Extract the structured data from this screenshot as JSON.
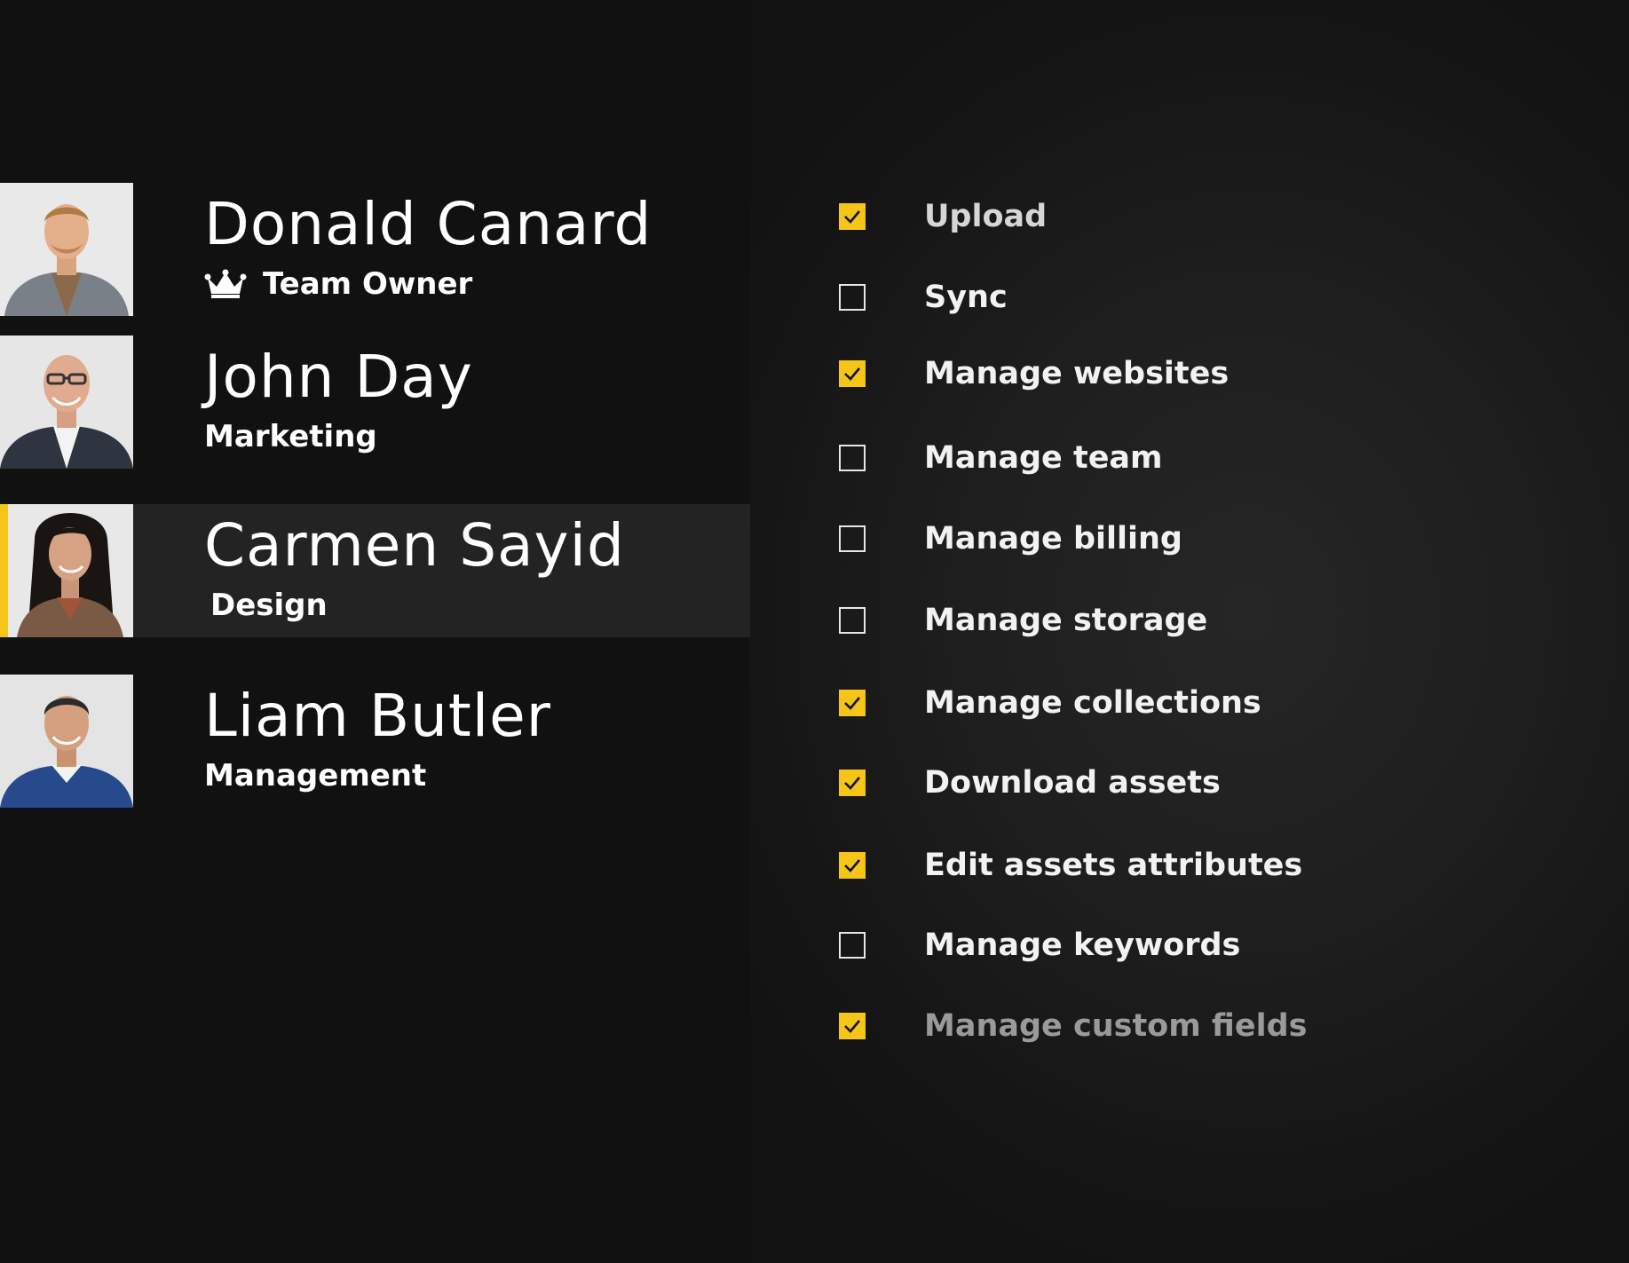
{
  "colors": {
    "accent": "#f5c518",
    "background": "#111111",
    "selected_row": "#232323"
  },
  "members": [
    {
      "name": "Donald Canard",
      "role": "Team Owner",
      "role_icon": "crown-icon",
      "selected": false
    },
    {
      "name": "John Day",
      "role": "Marketing",
      "selected": false
    },
    {
      "name": "Carmen Sayid",
      "role": "Design",
      "selected": true
    },
    {
      "name": "Liam Butler",
      "role": "Management",
      "selected": false
    }
  ],
  "permissions": [
    {
      "label": "Upload",
      "checked": true
    },
    {
      "label": "Sync",
      "checked": false
    },
    {
      "label": "Manage websites",
      "checked": true
    },
    {
      "label": "Manage team",
      "checked": false
    },
    {
      "label": "Manage billing",
      "checked": false
    },
    {
      "label": "Manage storage",
      "checked": false
    },
    {
      "label": "Manage collections",
      "checked": true
    },
    {
      "label": "Download assets",
      "checked": true
    },
    {
      "label": "Edit assets attributes",
      "checked": true
    },
    {
      "label": "Manage keywords",
      "checked": false
    },
    {
      "label": "Manage custom fields",
      "checked": true
    }
  ]
}
